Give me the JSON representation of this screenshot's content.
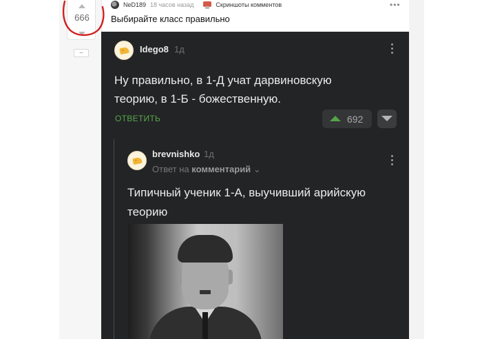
{
  "rating": {
    "value": "666",
    "collapse_label": "–"
  },
  "post": {
    "author": "NeD189",
    "time_ago": "18 часов назад",
    "screenshots_label": "Скриншоты комментов",
    "more_label": "•••",
    "text": "Выбирайте класс правильно"
  },
  "comment1": {
    "author": "Idego8",
    "time": "1д",
    "text_line1": "Ну правильно, в 1-Д учат дарвиновскую",
    "text_line2": "теорию, в 1-Б - божественную.",
    "reply_label": "ОТВЕТИТЬ",
    "votes": "692"
  },
  "comment2": {
    "author": "brevnishko",
    "time": "1д",
    "reply_to_prefix": "Ответ на",
    "reply_to_target": "комментарий",
    "reply_to_chevron": "⌄",
    "text_line1": "Типичный ученик 1-А, выучивший арийскую",
    "text_line2": "теорию"
  },
  "colors": {
    "dark_bg": "#232425",
    "accent_green": "#57a84c",
    "annotation_red": "#d21f1f"
  },
  "icons": [
    "arrow-up-icon",
    "arrow-down-icon",
    "screenshot-icon",
    "kebab-icon",
    "cheese-avatar-icon",
    "chevron-down-icon"
  ]
}
